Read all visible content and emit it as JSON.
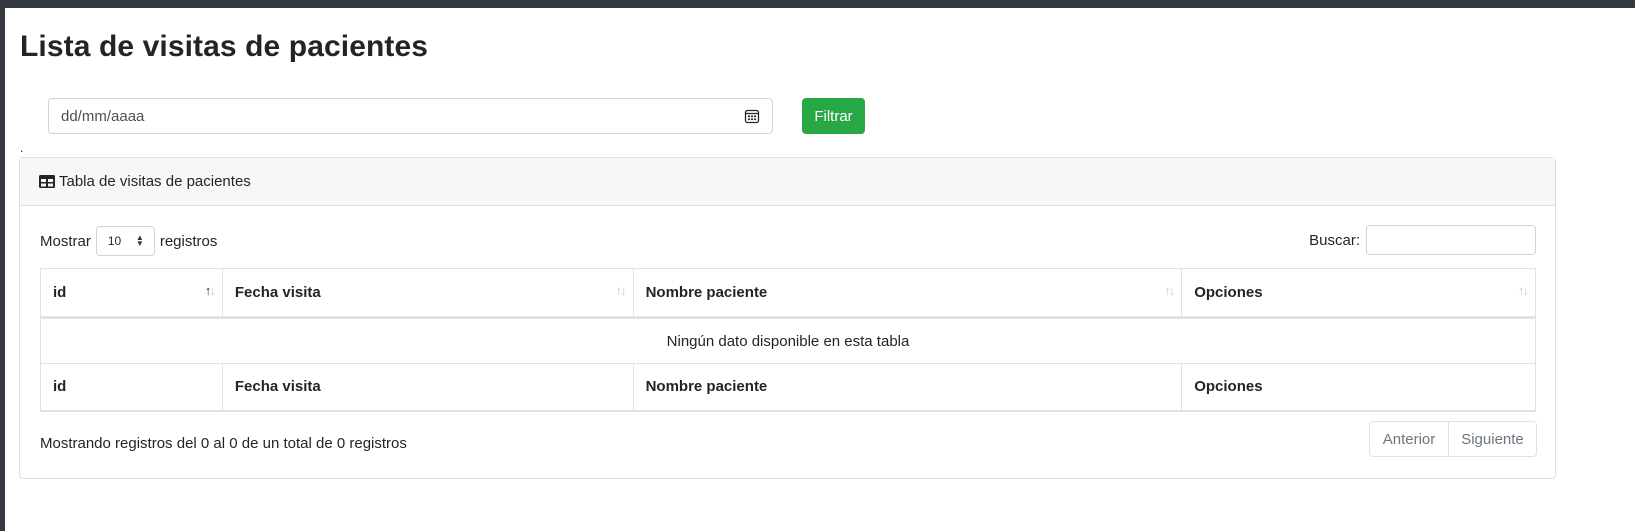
{
  "page": {
    "title": "Lista de visitas de pacientes",
    "dot": "."
  },
  "filter": {
    "date_placeholder": "dd/mm/aaaa",
    "button_label": "Filtrar",
    "icon": "calendar-icon"
  },
  "card": {
    "title": "Tabla de visitas de pacientes",
    "icon": "table-icon"
  },
  "length": {
    "prefix": "Mostrar",
    "value": "10",
    "suffix": "registros"
  },
  "search": {
    "label": "Buscar:",
    "value": ""
  },
  "table": {
    "columns": [
      "id",
      "Fecha visita",
      "Nombre paciente",
      "Opciones"
    ],
    "empty_message": "Ningún dato disponible en esta tabla"
  },
  "info": "Mostrando registros del 0 al 0 de un total de 0 registros",
  "pagination": {
    "previous": "Anterior",
    "next": "Siguiente"
  },
  "colors": {
    "primary_button": "#28a745",
    "topbar": "#343a40"
  }
}
